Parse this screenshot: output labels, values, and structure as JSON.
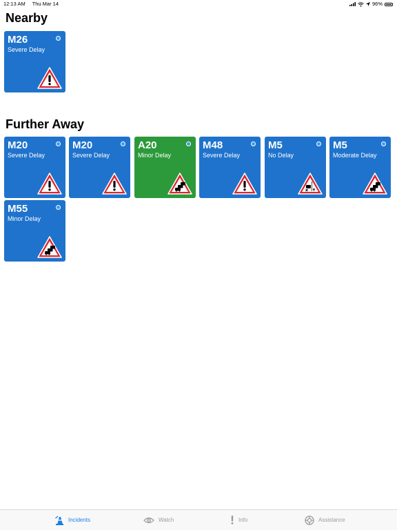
{
  "status_bar": {
    "time": "12:13 AM",
    "date": "Thu Mar 14",
    "battery_percent": "96%",
    "battery_level": 0.96
  },
  "sections": {
    "nearby": {
      "title": "Nearby"
    },
    "further": {
      "title": "Further Away"
    }
  },
  "colors": {
    "card_blue": "#1f73cc",
    "card_green": "#2c9a3a",
    "dot_fill": "#3d98f0",
    "sign_red": "#d9282f",
    "tab_active": "#1a7ee6",
    "tab_inactive": "#9a9a9a"
  },
  "nearby_cards": [
    {
      "road": "M26",
      "status": "Severe Delay",
      "color": "blue",
      "sign_icon": "warning-exclamation-sign-icon"
    }
  ],
  "further_cards": [
    {
      "road": "M20",
      "status": "Severe Delay",
      "color": "blue",
      "sign_icon": "warning-exclamation-sign-icon"
    },
    {
      "road": "M20",
      "status": "Severe Delay",
      "color": "blue",
      "sign_icon": "warning-exclamation-sign-icon"
    },
    {
      "road": "A20",
      "status": "Minor Delay",
      "color": "green",
      "sign_icon": "queues-likely-sign-icon"
    },
    {
      "road": "M48",
      "status": "Severe Delay",
      "color": "blue",
      "sign_icon": "warning-exclamation-sign-icon"
    },
    {
      "road": "M5",
      "status": "No Delay",
      "color": "blue",
      "sign_icon": "lane-closed-sign-icon"
    },
    {
      "road": "M5",
      "status": "Moderate Delay",
      "color": "blue",
      "sign_icon": "queues-likely-sign-icon"
    },
    {
      "road": "M55",
      "status": "Minor Delay",
      "color": "blue",
      "sign_icon": "queues-likely-sign-icon"
    }
  ],
  "tab_bar": {
    "incidents": {
      "label": "Incidents",
      "icon": "incidents-cone-icon"
    },
    "watch": {
      "label": "Watch",
      "icon": "eye-icon"
    },
    "info": {
      "label": "Info",
      "icon": "exclamation-icon"
    },
    "assistance": {
      "label": "Assistance",
      "icon": "lifebuoy-icon"
    }
  }
}
